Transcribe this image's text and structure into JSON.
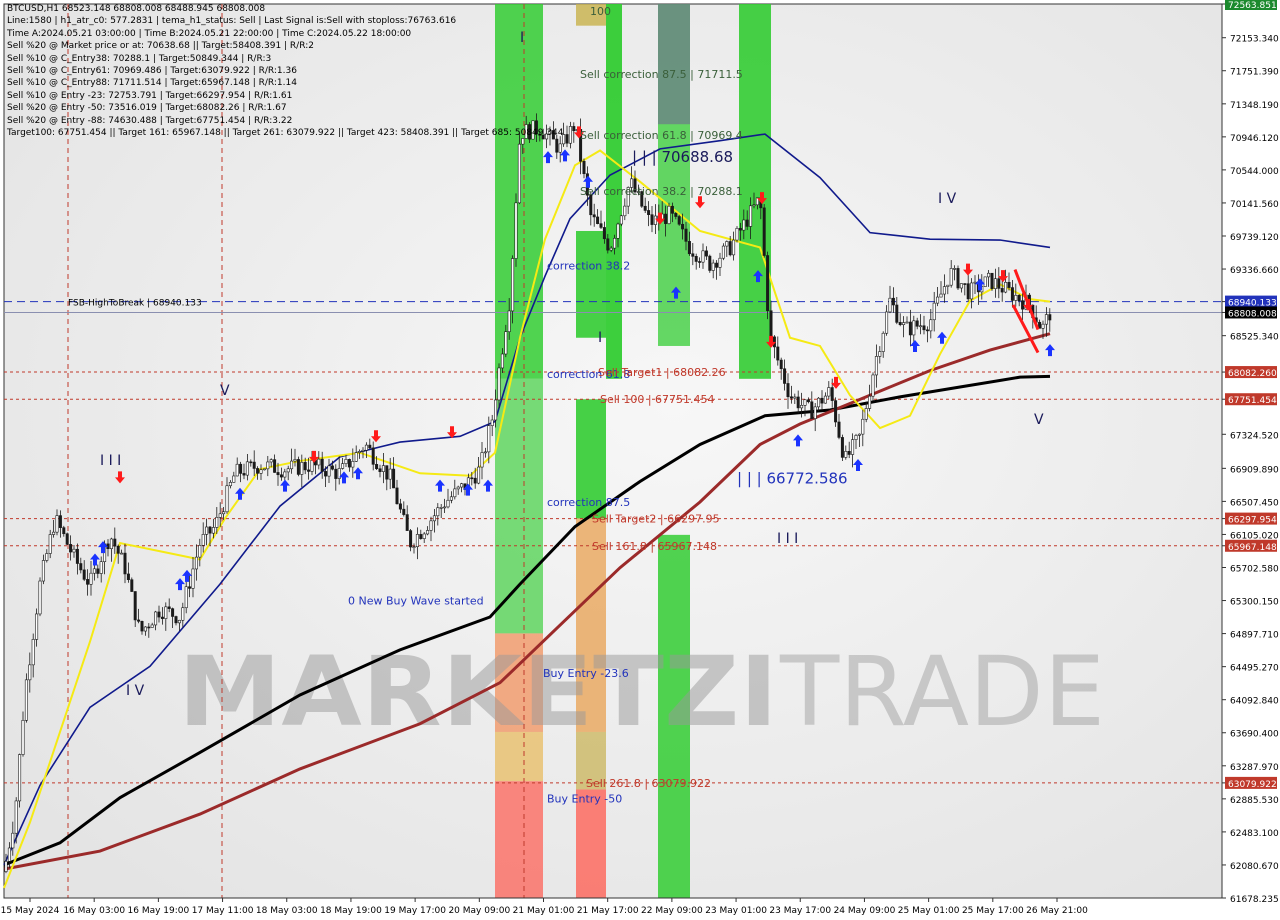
{
  "info_panel": [
    "BTCUSD,H1  68523.148 68808.008 68488.945 68808.008",
    "Line:1580 | h1_atr_c0: 577.2831 | tema_h1_status: Sell | Last Signal is:Sell with stoploss:76763.616",
    "Time A:2024.05.21 03:00:00 | Time B:2024.05.21 22:00:00 | Time C:2024.05.22 18:00:00",
    "Sell %20 @ Market price or at: 70638.68 || Target:58408.391 | R/R:2",
    "Sell %10 @ C_Entry38: 70288.1 | Target:50849.344 | R/R:3",
    "Sell %10 @ C_Entry61: 70969.486 | Target:63079.922 | R/R:1.36",
    "Sell %10 @ C_Entry88: 71711.514 | Target:65967.148 | R/R:1.14",
    "Sell %10 @ Entry -23: 72753.791 | Target:66297.954 | R/R:1.61",
    "Sell %20 @ Entry -50: 73516.019 | Target:68082.26 | R/R:1.67",
    "Sell %20 @ Entry -88: 74630.488 | Target:67751.454 | R/R:3.22",
    "Target100: 67751.454 || Target 161: 65967.148 || Target 261: 63079.922 || Target 423: 58408.391 || Target 685: 50849.344"
  ],
  "watermark": {
    "bold": "MARKETZI",
    "light": "TRADE"
  },
  "colors": {
    "ema_black": "#000000",
    "ema_brown": "#9b2a2a",
    "ma_blue": "#101a8c",
    "ma_yellow": "#f5ea14",
    "green_zone": "#33cc33",
    "red_zone": "#ff5a4e",
    "buy_arrow": "#1a33ff",
    "sell_arrow": "#ff1a1a",
    "level_line": "#c0392b",
    "blue_dash": "#2233bb"
  },
  "chart_data": {
    "type": "candlestick",
    "symbol": "BTCUSD",
    "timeframe": "H1",
    "ohlc_last": {
      "open": 68523.148,
      "high": 68808.008,
      "low": 68488.945,
      "close": 68808.008
    },
    "y_range": [
      61678.235,
      72563.851
    ],
    "y_tick_labels": [
      "72563.851",
      "72153.340",
      "71751.390",
      "71348.190",
      "70946.120",
      "70544.000",
      "70141.560",
      "69739.120",
      "69336.660",
      "68940.133",
      "68808.008",
      "68525.340",
      "68082.260",
      "67751.454",
      "67324.520",
      "66909.890",
      "66507.450",
      "66297.954",
      "66105.020",
      "65967.148",
      "65702.580",
      "65300.150",
      "64897.710",
      "64495.270",
      "64092.840",
      "63690.400",
      "63287.970",
      "63079.922",
      "62885.530",
      "62483.100",
      "62080.670",
      "61678.235"
    ],
    "highlighted_levels": [
      {
        "value": 72563.851,
        "label": "72563.851",
        "bg": "#1c8a2e"
      },
      {
        "value": 68940.133,
        "label": "68940.133",
        "bg": "#2233bb"
      },
      {
        "value": 68808.008,
        "label": "68808.008",
        "bg": "#000000"
      },
      {
        "value": 68082.26,
        "label": "68082.260",
        "bg": "#c0392b"
      },
      {
        "value": 67751.454,
        "label": "67751.454",
        "bg": "#c0392b"
      },
      {
        "value": 66297.954,
        "label": "66297.954",
        "bg": "#c0392b"
      },
      {
        "value": 65967.148,
        "label": "65967.148",
        "bg": "#c0392b"
      },
      {
        "value": 63079.922,
        "label": "63079.922",
        "bg": "#c0392b"
      }
    ],
    "horizontal_levels": [
      {
        "value": 68940.133,
        "style": "dashed",
        "color": "#2233bb"
      },
      {
        "value": 68808.008,
        "style": "solid",
        "color": "#8a8fb0"
      },
      {
        "value": 68082.26,
        "style": "dotted",
        "color": "#c0392b"
      },
      {
        "value": 67751.454,
        "style": "dotted",
        "color": "#c0392b"
      },
      {
        "value": 66297.954,
        "style": "dotted",
        "color": "#c0392b"
      },
      {
        "value": 65967.148,
        "style": "dotted",
        "color": "#c0392b"
      },
      {
        "value": 63079.922,
        "style": "dotted",
        "color": "#c0392b"
      }
    ],
    "x_tick_labels": [
      "15 May 2024",
      "16 May 03:00",
      "16 May 19:00",
      "17 May 11:00",
      "18 May 03:00",
      "18 May 19:00",
      "19 May 17:00",
      "20 May 09:00",
      "21 May 01:00",
      "21 May 17:00",
      "22 May 09:00",
      "23 May 01:00",
      "23 May 17:00",
      "24 May 09:00",
      "25 May 01:00",
      "25 May 17:00",
      "26 May 21:00"
    ],
    "annotations": [
      {
        "text": "FSB-HighToBreak | 68940.133",
        "price": 68940.133,
        "color": "#000000"
      },
      {
        "text": "Sell correction 87.5 | 71711.5",
        "price": 71711.5,
        "color": "#3a5f3a"
      },
      {
        "text": "| | | 70688.68",
        "price": 70688.68,
        "color": "#1a1a5a"
      },
      {
        "text": "Sell correction 61.8 | 70969.4",
        "price": 70969.4,
        "color": "#3a5f3a"
      },
      {
        "text": "Sell correction 38.2 | 70288.1",
        "price": 70288.1,
        "color": "#3a5f3a"
      },
      {
        "text": "correction 38.2",
        "price": 69380,
        "color": "#2233bb"
      },
      {
        "text": "correction 61.8",
        "price": 68060,
        "color": "#2233bb"
      },
      {
        "text": "Sell Target1 | 68082.26",
        "price": 68082.26,
        "color": "#c0392b"
      },
      {
        "text": "Sell 100 | 67751.454",
        "price": 67751.454,
        "color": "#c0392b"
      },
      {
        "text": "correction 87.5",
        "price": 66500,
        "color": "#2233bb"
      },
      {
        "text": "Sell Target2 | 66297.95",
        "price": 66297.95,
        "color": "#c0392b"
      },
      {
        "text": "Sell 161.8 | 65967.148",
        "price": 65967.148,
        "color": "#c0392b"
      },
      {
        "text": "| | | 66772.586",
        "price": 66772.586,
        "color": "#2233bb"
      },
      {
        "text": "0 New Buy Wave started",
        "price": 65300,
        "color": "#2233bb"
      },
      {
        "text": "Buy Entry -23.6",
        "price": 64420,
        "color": "#2233bb"
      },
      {
        "text": "Buy Entry -50",
        "price": 62890,
        "color": "#2233bb"
      },
      {
        "text": "Sell  261.8 | 63079.922",
        "price": 63079.922,
        "color": "#c0392b"
      },
      {
        "text": "100",
        "price": 72480,
        "color": "#3a5f3a"
      }
    ],
    "wave_labels": [
      {
        "text": "I",
        "price": 72100
      },
      {
        "text": "I I I",
        "price": 66950
      },
      {
        "text": "I V",
        "price": 64150
      },
      {
        "text": "V",
        "price": 67800
      },
      {
        "text": "I",
        "price": 68450
      },
      {
        "text": "I V",
        "price": 70141
      },
      {
        "text": "V",
        "price": 67450
      },
      {
        "text": "I I I",
        "price": 66000
      }
    ],
    "grid": false
  }
}
